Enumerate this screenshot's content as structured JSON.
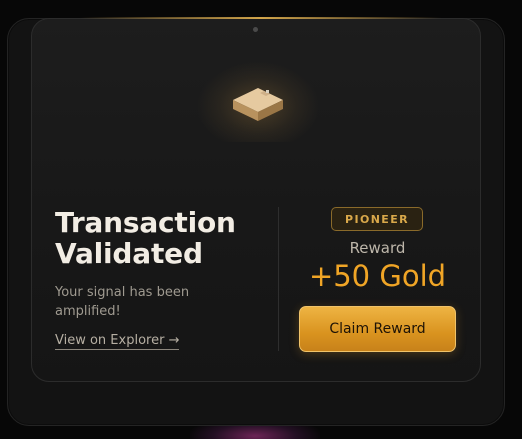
{
  "card": {
    "title": "Transaction Validated",
    "subtitle": "Your signal has been amplified!",
    "explorer_link": "View on Explorer →",
    "icon": "box-icon"
  },
  "reward": {
    "badge": "PIONEER",
    "label": "Reward",
    "amount": "+50 Gold",
    "claim_button": "Claim Reward"
  },
  "colors": {
    "accent_gold": "#f0a526",
    "button_gold": "#e3a233",
    "background": "#070707",
    "card": "#1a1a1a"
  }
}
